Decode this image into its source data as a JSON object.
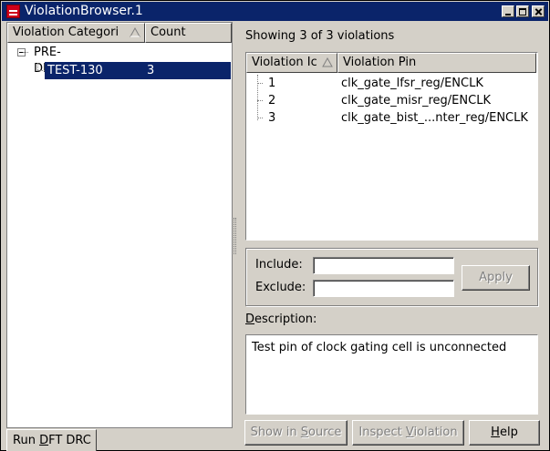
{
  "window": {
    "title": "ViolationBrowser.1"
  },
  "left_panel": {
    "columns": {
      "category": "Violation Categori",
      "count": "Count"
    },
    "tree": {
      "root": "PRE-DFT",
      "child": {
        "name": "TEST-130",
        "count": "3"
      }
    }
  },
  "violations": {
    "summary": "Showing 3 of 3 violations",
    "columns": {
      "id": "Violation Ic",
      "pin": "Violation Pin"
    },
    "rows": [
      {
        "id": "1",
        "pin": "clk_gate_lfsr_reg/ENCLK"
      },
      {
        "id": "2",
        "pin": "clk_gate_misr_reg/ENCLK"
      },
      {
        "id": "3",
        "pin": "clk_gate_bist_...nter_reg/ENCLK"
      }
    ]
  },
  "filter": {
    "include_label": "Include:",
    "include_value": "",
    "exclude_label": "Exclude:",
    "exclude_value": "",
    "apply_label": "Apply"
  },
  "description": {
    "label_first": "D",
    "label_rest": "escription:",
    "text": "Test pin of clock gating cell is unconnected"
  },
  "buttons": {
    "show_in_source": {
      "pre": "Show in ",
      "ul": "S",
      "post": "ource"
    },
    "inspect_violation": {
      "pre": "Inspect ",
      "ul": "V",
      "post": "iolation"
    },
    "help": {
      "pre": "",
      "ul": "H",
      "post": "elp"
    }
  },
  "bottom_tab": {
    "pre": "Run ",
    "ul": "D",
    "post": "FT DRC"
  }
}
